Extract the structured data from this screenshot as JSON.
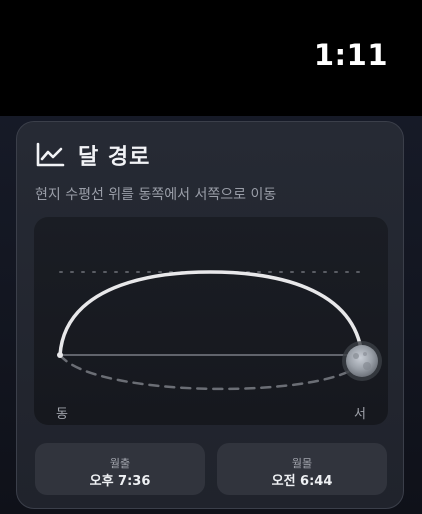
{
  "status_bar": {
    "time": "1:11"
  },
  "card": {
    "title": "달 경로",
    "icon": "line-chart-icon",
    "subtitle": "현지 수평선 위를 동쪽에서 서쪽으로 이동",
    "direction_east": "동",
    "direction_west": "서",
    "moonrise": {
      "label": "월출",
      "value": "오후 7:36"
    },
    "moonset": {
      "label": "월몰",
      "value": "오전 6:44"
    }
  },
  "chart_data": {
    "type": "line",
    "description_axis": "horizon",
    "x_start_label": "동",
    "x_end_label": "서",
    "moon_progress": 1.0,
    "colors": {
      "arc_above": "#e8e8ea",
      "arc_below": "#6b6e75",
      "horizon": "#7a7d85",
      "moon": "#9aa0a8"
    }
  }
}
